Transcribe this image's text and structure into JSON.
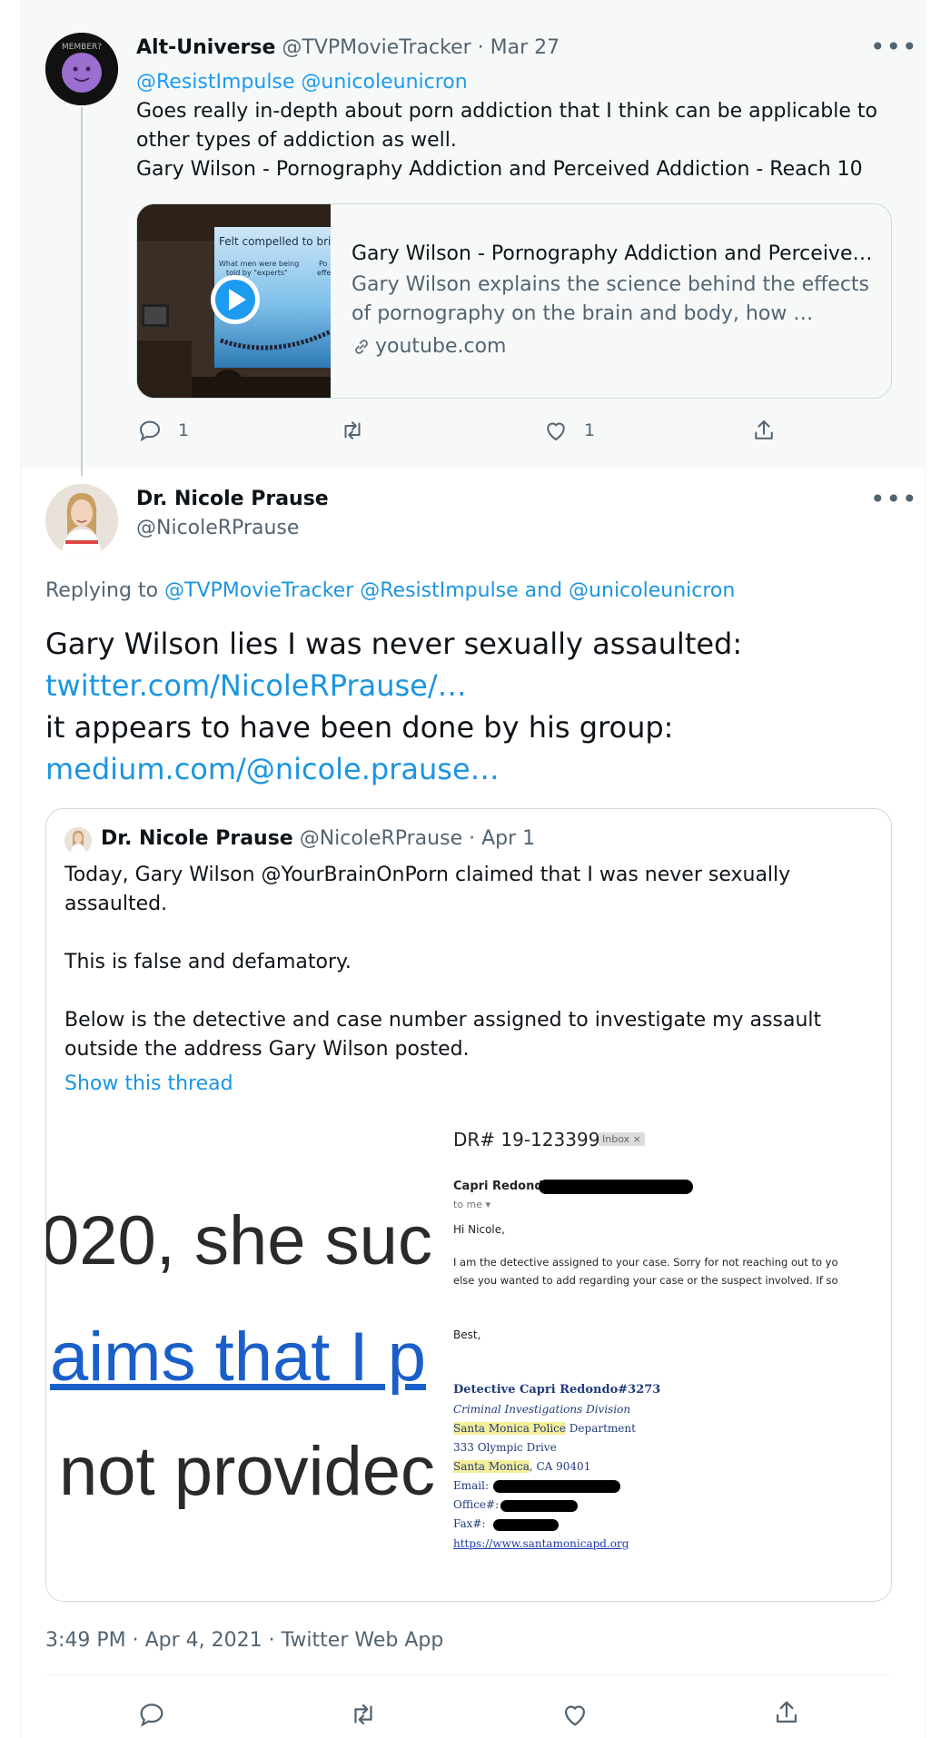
{
  "parent_tweet": {
    "display_name": "Alt-Universe",
    "handle_date": "@TVPMovieTracker · Mar 27",
    "mentions": "@ResistImpulse @unicoleunicron",
    "text_line1": "Goes really in-depth about porn addiction that I think can be applicable to",
    "text_line2": "other types of addiction as well.",
    "text_line3": "Gary Wilson - Pornography Addiction and Perceived Addiction - Reach 10",
    "avatar_badge": "MEMBER?",
    "card": {
      "title": "Gary Wilson - Pornography Addiction and Perceive…",
      "desc_line1": "Gary Wilson explains the science behind the effects",
      "desc_line2": "of pornography on the brain and body, how …",
      "domain": "youtube.com",
      "slide_title": "Felt compelled to brin",
      "slide_sub1": "What men were being",
      "slide_sub2": "told by \"experts\"",
      "slide_po": "Po",
      "slide_effe": "effe"
    },
    "actions": {
      "reply_count": "1",
      "like_count": "1"
    }
  },
  "main_tweet": {
    "display_name": "Dr. Nicole Prause",
    "handle": "@NicoleRPrause",
    "replying_prefix": "Replying to ",
    "replying_users": "@TVPMovieTracker @ResistImpulse and @unicoleunicron",
    "text_line1": "Gary Wilson lies I was never sexually assaulted:",
    "link1": "twitter.com/NicoleRPrause/…",
    "text_line2": "it appears to have been done by his group:",
    "link2": "medium.com/@nicole.prause…",
    "timestamp": "3:49 PM · Apr 4, 2021 · Twitter Web App"
  },
  "quoted_tweet": {
    "display_name": "Dr. Nicole Prause",
    "handle_date": "@NicoleRPrause · Apr 1",
    "p1_line1": "Today, Gary Wilson @YourBrainOnPorn claimed that I was never sexually",
    "p1_line2": "assaulted.",
    "p2": "This is false and defamatory.",
    "p3_line1": "Below is the detective and case number assigned to investigate my assault",
    "p3_line2": "outside the address Gary Wilson posted.",
    "show_thread": "Show this thread",
    "image_left": {
      "line1": "020, she suc",
      "line2": "aims that I p",
      "line3": "not providec"
    },
    "email": {
      "subject": "DR# 19-123399",
      "badge": "Inbox ×",
      "sender": "Capri Redondo",
      "to": "to me ▾",
      "greeting": "Hi Nicole,",
      "body1": "I am the detective assigned to your case. Sorry for not reaching out to yo",
      "body2": "else you wanted to add regarding your case or the suspect involved. If so",
      "closing": "Best,",
      "sig_name": "Detective Capri Redondo#3273",
      "sig_div": "Criminal Investigations Division",
      "sig_dept_hl": "Santa Monica Police",
      "sig_dept_rest": " Department",
      "sig_addr": "333 Olympic Drive",
      "sig_city_hl": "Santa Monica",
      "sig_city_rest": ", CA 90401",
      "sig_email": "Email:",
      "sig_office": "Office#:",
      "sig_fax": "Fax#:",
      "sig_url": "https://www.santamonicapd.org"
    }
  },
  "colors": {
    "accent": "#1d9bf0",
    "secondary": "#536471",
    "border": "#cfd9de"
  }
}
